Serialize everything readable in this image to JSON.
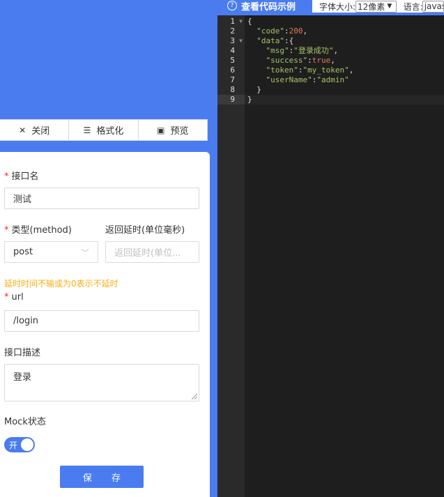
{
  "toolbar": {
    "close_label": "关闭",
    "format_label": "格式化",
    "preview_label": "预览"
  },
  "form": {
    "name_label": "接口名",
    "name_value": "测试",
    "type_label": "类型(method)",
    "type_value": "post",
    "delay_label": "返回延时(单位毫秒)",
    "delay_placeholder": "返回延时(单位...",
    "delay_hint": "延时时间不输或为0表示不延时",
    "url_label": "url",
    "url_value": "/login",
    "desc_label": "接口描述",
    "desc_value": "登录",
    "mock_label": "Mock状态",
    "mock_toggle_text": "开",
    "save_label": "保 存"
  },
  "code_panel": {
    "title": "查看代码示例",
    "font_size_label": "字体大小:",
    "font_size_value": "12像素",
    "language_label": "语言:",
    "language_value": "javas",
    "line_numbers": [
      "1",
      "2",
      "3",
      "4",
      "5",
      "6",
      "7",
      "8",
      "9"
    ],
    "lines": [
      "{",
      "  \"code\":200,",
      "  \"data\":{",
      "    \"msg\":\"登录成功\",",
      "    \"success\":true,",
      "    \"token\":\"my_token\",",
      "    \"userName\":\"admin\"",
      "  }",
      "}"
    ]
  },
  "colors": {
    "brand_blue": "#4a7cf0",
    "editor_bg": "#1e1e1e",
    "hint_orange": "#faad14",
    "required_red": "#f5222d"
  }
}
